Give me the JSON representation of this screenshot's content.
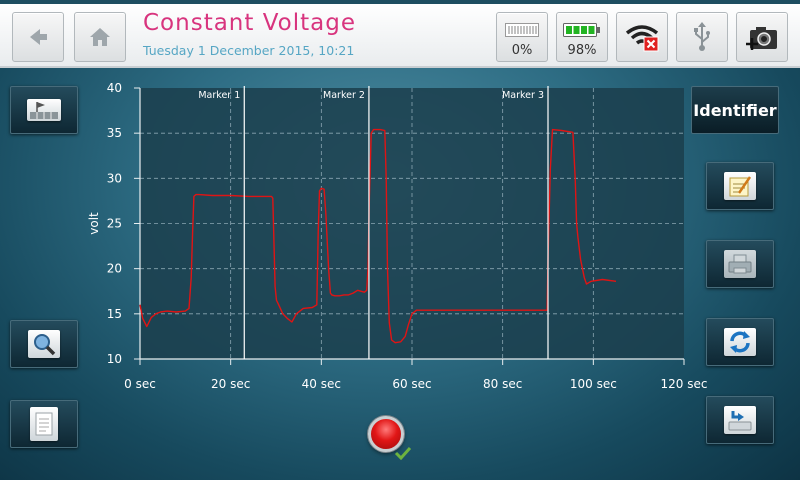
{
  "header": {
    "title": "Constant Voltage",
    "datetime": "Tuesday 1 December 2015, 10:21",
    "memory_label": "0%",
    "battery_label": "98%",
    "icons": {
      "back": "back-arrow-icon",
      "home": "home-icon",
      "memory": "memory-gauge-icon",
      "battery": "battery-icon",
      "wifi": "wifi-disconnected-icon",
      "usb": "usb-icon",
      "camera": "camera-add-icon"
    }
  },
  "sidebar_left": {
    "icons": [
      "flag-marker-icon",
      "zoom-icon",
      "document-icon"
    ]
  },
  "sidebar_right": {
    "identifier_label": "Identifier",
    "icons": [
      "notepad-icon",
      "print-icon",
      "refresh-icon",
      "save-drive-icon"
    ]
  },
  "record": {
    "icon": "record-icon",
    "status_icon": "check-icon"
  },
  "colors": {
    "title": "#d8347e",
    "datetime": "#56a6c4",
    "trace": "#e01414",
    "marker": "#ffffff",
    "plot_bg": "#1b3e4c"
  },
  "chart_data": {
    "type": "line",
    "title": "",
    "xlabel": "",
    "ylabel": "volt",
    "xlim": [
      0,
      120
    ],
    "ylim": [
      10,
      40
    ],
    "x_ticks": [
      0,
      20,
      40,
      60,
      80,
      100,
      120
    ],
    "x_tick_labels": [
      "0 sec",
      "20 sec",
      "40 sec",
      "60 sec",
      "80 sec",
      "100 sec",
      "120 sec"
    ],
    "y_ticks": [
      10,
      15,
      20,
      25,
      30,
      35,
      40
    ],
    "grid": true,
    "markers": [
      {
        "label": "Marker 1",
        "x": 23
      },
      {
        "label": "Marker 2",
        "x": 50.5
      },
      {
        "label": "Marker 3",
        "x": 90
      }
    ],
    "series": [
      {
        "x": [
          0,
          0.6,
          1.5,
          2.5,
          3.5,
          4.5,
          6,
          8,
          10,
          10.8,
          11.3,
          11.6,
          11.9,
          12.3,
          13,
          16,
          20,
          24,
          28,
          29,
          29.3,
          29.5,
          29.8,
          30.1,
          30.6,
          31.5,
          32.5,
          33,
          33.5,
          34.5,
          36,
          38,
          39,
          39.3,
          39.6,
          40,
          40.6,
          41,
          41.6,
          42,
          42.3,
          43,
          44,
          45,
          46,
          47,
          48,
          49.5,
          50,
          50.3,
          50.6,
          51,
          51.5,
          52,
          53,
          54,
          54.3,
          54.6,
          55,
          55.5,
          56.3,
          57.5,
          58.5,
          59.2,
          60,
          61,
          70,
          80,
          89.8,
          90,
          90.5,
          91,
          93,
          95.5,
          96,
          96.3,
          96.6,
          97.2,
          98,
          98.5,
          99.5,
          102,
          105
        ],
        "y": [
          16,
          14.5,
          13.6,
          14.6,
          15,
          15.2,
          15.3,
          15.2,
          15.3,
          15.6,
          19,
          24,
          28,
          28.2,
          28.2,
          28.1,
          28.1,
          28,
          28,
          28,
          27.8,
          24,
          18,
          16.5,
          16,
          15,
          14.5,
          14.3,
          14.1,
          15,
          15.6,
          15.7,
          16,
          24,
          28.6,
          28.9,
          28.8,
          26,
          20,
          17.3,
          17.1,
          17,
          17,
          17.1,
          17.1,
          17.3,
          17.6,
          17.4,
          17.6,
          20,
          28,
          35,
          35.4,
          35.4,
          35.4,
          35.3,
          30,
          20,
          14,
          12.1,
          11.8,
          11.9,
          12.5,
          13.8,
          15,
          15.4,
          15.4,
          15.4,
          15.4,
          21,
          31,
          35.4,
          35.3,
          35.1,
          30,
          25,
          23.5,
          21,
          19,
          18.3,
          18.6,
          18.8,
          18.6
        ]
      }
    ]
  }
}
